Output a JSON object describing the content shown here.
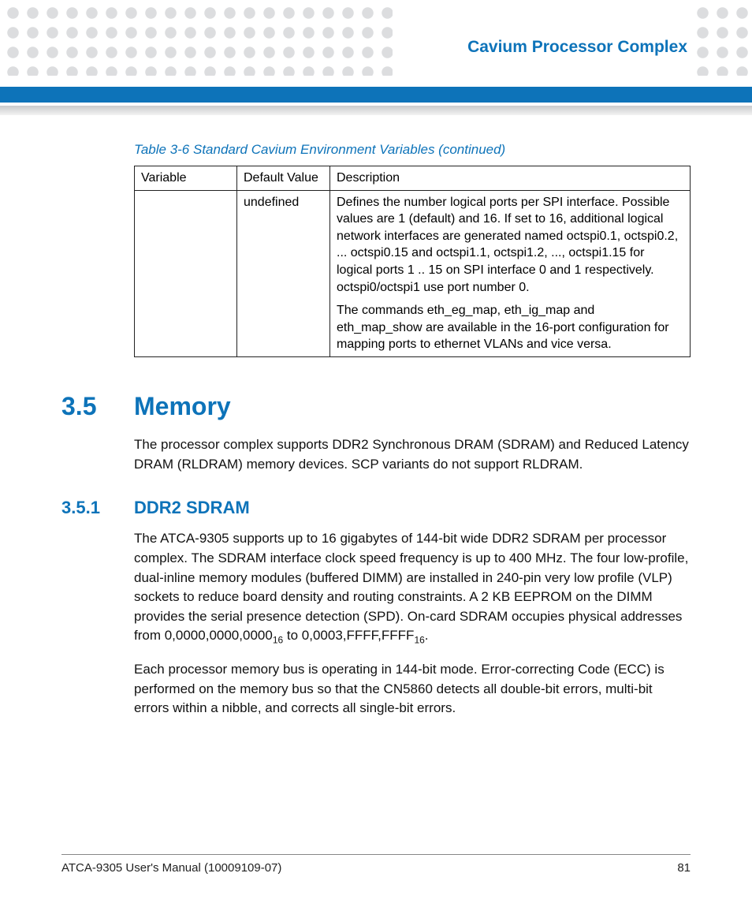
{
  "header": {
    "title": "Cavium Processor Complex"
  },
  "table": {
    "caption": "Table 3-6 Standard Cavium Environment Variables (continued)",
    "headers": {
      "c0": "Variable",
      "c1": "Default Value",
      "c2": "Description"
    },
    "row": {
      "variable": "",
      "default": "undefined",
      "desc_p1": "Defines the number logical ports per SPI interface. Possible values are 1 (default) and 16. If set to 16, additional logical network interfaces are generated named octspi0.1, octspi0.2, ... octspi0.15 and octspi1.1, octspi1.2, ..., octspi1.15 for logical ports 1 .. 15 on SPI interface 0 and 1 respectively. octspi0/octspi1 use port number 0.",
      "desc_p2": "The commands eth_eg_map, eth_ig_map and eth_map_show are available in the 16-port configuration for mapping ports to ethernet VLANs and vice versa."
    }
  },
  "sec35": {
    "num": "3.5",
    "title": "Memory",
    "para": "The processor complex supports DDR2 Synchronous DRAM (SDRAM) and Reduced Latency DRAM (RLDRAM) memory devices. SCP variants do not support RLDRAM."
  },
  "sec351": {
    "num": "3.5.1",
    "title": "DDR2 SDRAM",
    "para1_a": "The ATCA-9305 supports up to 16 gigabytes of 144-bit wide DDR2 SDRAM per processor complex. The SDRAM interface clock speed frequency is up to 400 MHz. The four low-profile, dual-inline memory modules (buffered DIMM) are installed in 240-pin very low profile (VLP) sockets to reduce board density and routing constraints. A 2 KB EEPROM on the DIMM provides the serial presence detection (SPD). On-card SDRAM occupies physical addresses from 0,0000,0000,0000",
    "para1_sub1": "16",
    "para1_b": " to 0,0003,FFFF,FFFF",
    "para1_sub2": "16",
    "para1_c": ".",
    "para2": "Each processor memory bus is operating in 144-bit mode. Error-correcting Code (ECC) is performed on the memory bus so that the CN5860 detects all double-bit errors, multi-bit errors within a nibble, and corrects all single-bit errors."
  },
  "footer": {
    "left": "ATCA-9305 User's Manual (10009109-07)",
    "right": "81"
  }
}
